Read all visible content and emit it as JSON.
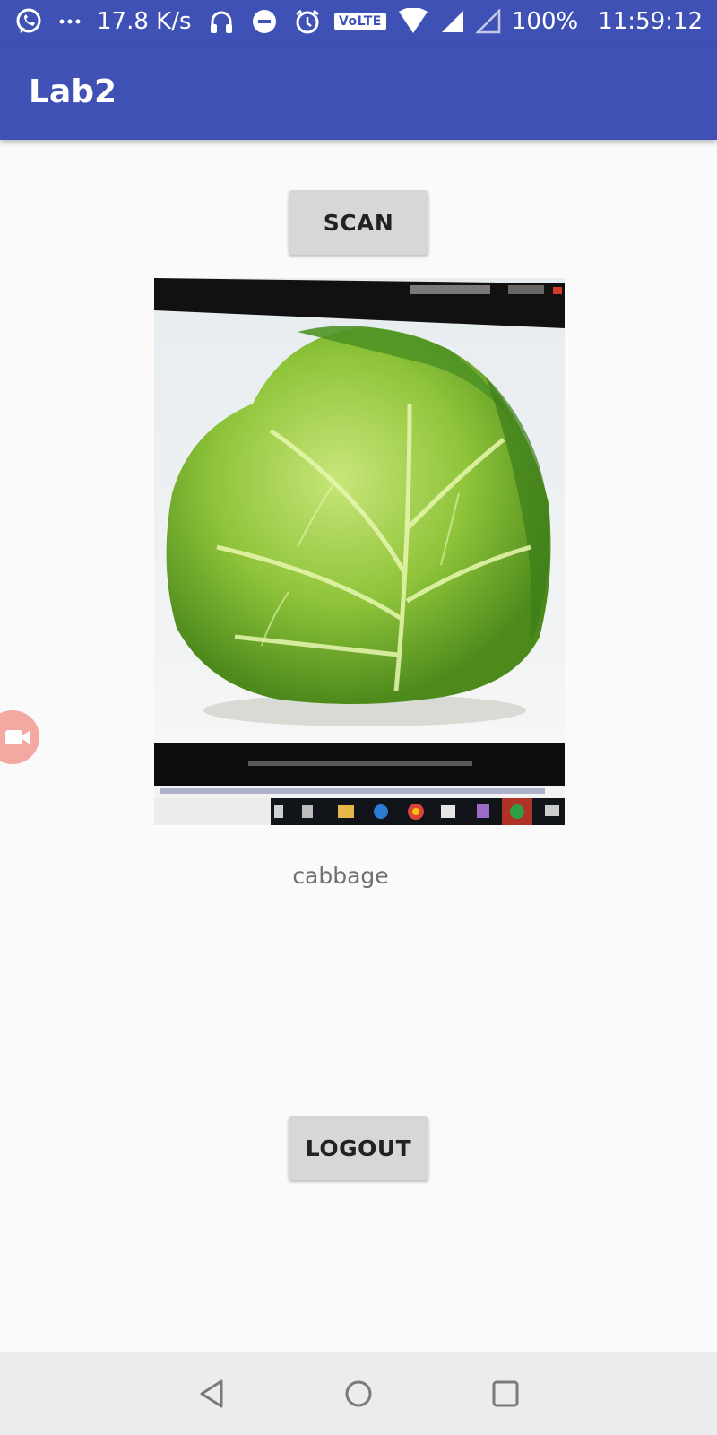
{
  "status_bar": {
    "net_speed": "17.8 K/s",
    "volte_label": "VoLTE",
    "battery": "100%",
    "time": "11:59:12",
    "icons": [
      "whatsapp-icon",
      "more-dots-icon",
      "headphones-icon",
      "dnd-icon",
      "alarm-icon",
      "volte-icon",
      "wifi-icon",
      "signal-icon",
      "signal-empty-icon"
    ]
  },
  "app_bar": {
    "title": "Lab2"
  },
  "main": {
    "scan_label": "SCAN",
    "result_label": "cabbage",
    "logout_label": "LOGOUT"
  },
  "nav_bar": {
    "icons": [
      "back-icon",
      "home-icon",
      "recents-icon"
    ]
  },
  "colors": {
    "primary": "#3f51b5",
    "button": "#d6d7d7",
    "background": "#fafafa"
  }
}
